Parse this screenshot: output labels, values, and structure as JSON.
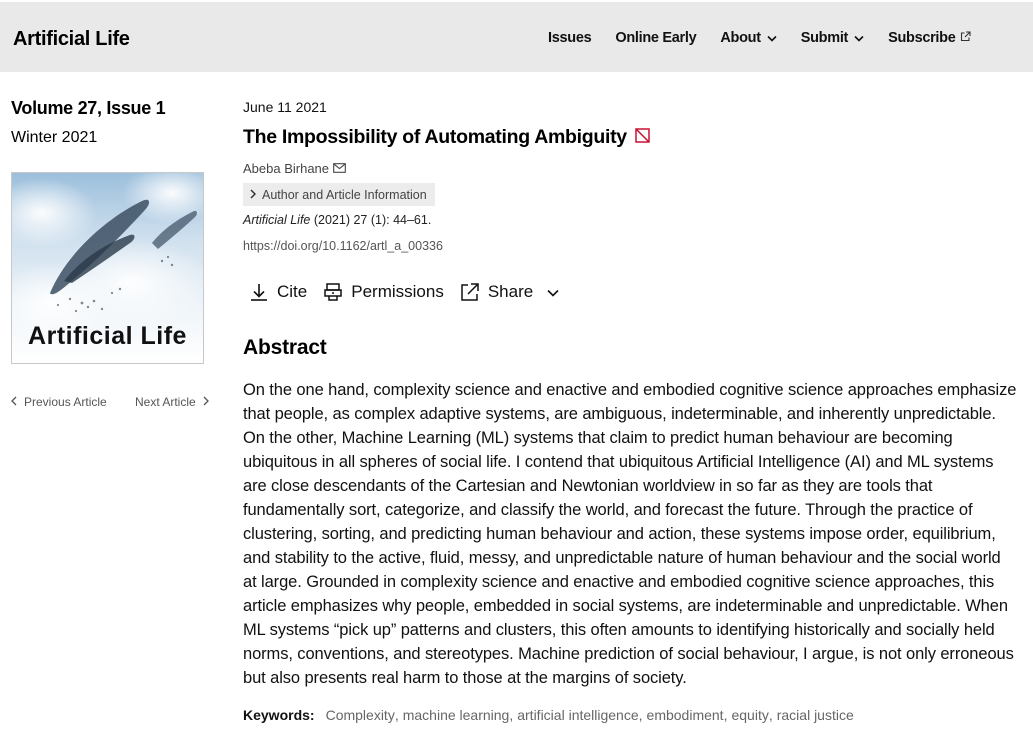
{
  "header": {
    "site_title": "Artificial Life",
    "nav": [
      {
        "label": "Issues",
        "has_chevron": false,
        "external": false
      },
      {
        "label": "Online Early",
        "has_chevron": false,
        "external": false
      },
      {
        "label": "About",
        "has_chevron": true,
        "external": false
      },
      {
        "label": "Submit",
        "has_chevron": true,
        "external": false
      },
      {
        "label": "Subscribe",
        "has_chevron": false,
        "external": true
      }
    ]
  },
  "issue": {
    "volume": "Volume 27, Issue 1",
    "season": "Winter 2021",
    "cover_title": "Artificial Life"
  },
  "article_nav": {
    "previous": "Previous Article",
    "next": "Next Article"
  },
  "article": {
    "date": "June 11 2021",
    "title": "The Impossibility of Automating Ambiguity",
    "author": "Abeba Birhane",
    "info_button": "Author and Article Information",
    "journal": "Artificial Life",
    "citation_rest": " (2021) 27 (1): 44–61.",
    "doi": "https://doi.org/10.1162/artl_a_00336"
  },
  "tools": {
    "cite": "Cite",
    "permissions": "Permissions",
    "share": "Share"
  },
  "abstract": {
    "heading": "Abstract",
    "text": "On the one hand, complexity science and enactive and embodied cognitive science approaches emphasize that people, as complex adaptive systems, are ambiguous, indeterminable, and inherently unpredictable. On the other, Machine Learning (ML) systems that claim to predict human behaviour are becoming ubiquitous in all spheres of social life. I contend that ubiquitous Artificial Intelligence (AI) and ML systems are close descendants of the Cartesian and Newtonian worldview in so far as they are tools that fundamentally sort, categorize, and classify the world, and forecast the future. Through the practice of clustering, sorting, and predicting human behaviour and action, these systems impose order, equilibrium, and stability to the active, fluid, messy, and unpredictable nature of human behaviour and the social world at large. Grounded in complexity science and enactive and embodied cognitive science approaches, this article emphasizes why people, embedded in social systems, are indeterminable and unpredictable. When ML systems “pick up” patterns and clusters, this often amounts to identifying historically and socially held norms, conventions, and stereotypes. Machine prediction of social behaviour, I argue, is not only erroneous but also presents real harm to those at the margins of society."
  },
  "keywords": {
    "label": "Keywords:",
    "items": [
      "Complexity",
      "machine learning",
      "artificial intelligence",
      "embodiment",
      "equity",
      "racial justice"
    ]
  },
  "colors": {
    "header_bg": "#e9e9e9",
    "access_icon": "#c8102e",
    "link_gray": "#666666"
  }
}
